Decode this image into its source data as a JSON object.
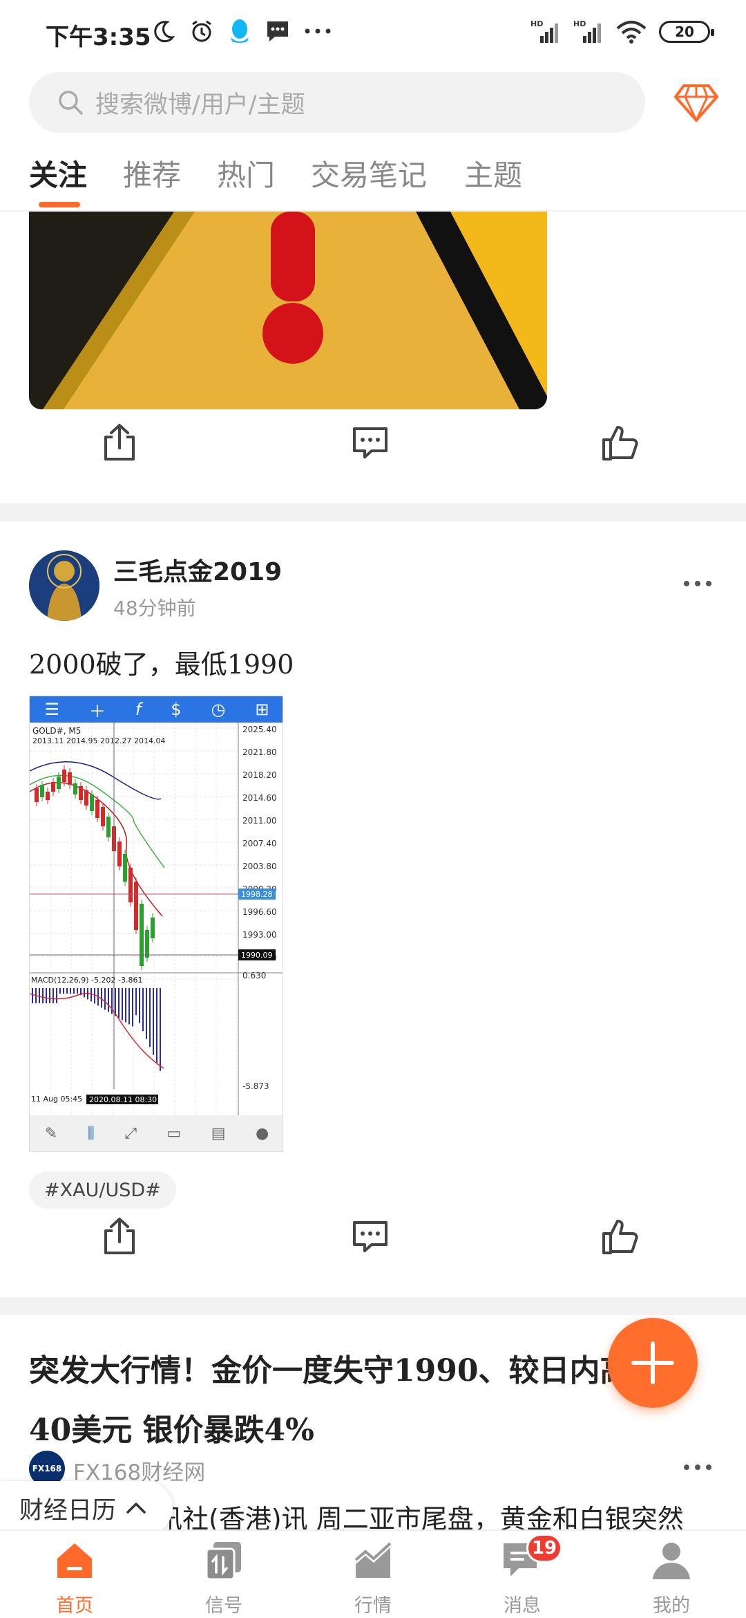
{
  "status_bar": {
    "time": "下午3:35",
    "network_labels": [
      "HD",
      "HD"
    ],
    "battery": "20"
  },
  "header": {
    "search_placeholder": "搜索微博/用户/主题",
    "search_icon": "search-icon",
    "vip_icon": "diamond-icon"
  },
  "tabs": [
    {
      "label": "关注",
      "active": true
    },
    {
      "label": "推荐",
      "active": false
    },
    {
      "label": "热门",
      "active": false
    },
    {
      "label": "交易笔记",
      "active": false
    },
    {
      "label": "主题",
      "active": false
    }
  ],
  "post2": {
    "author": "三毛点金2019",
    "time": "48分钟前",
    "text": "2000破了，最低1990",
    "tag": "#XAU/USD#",
    "chart": {
      "symbol": "GOLD#, M5",
      "ohlc": "2013.11 2014.95 2012.27 2014.04",
      "price_labels": [
        "2025.40",
        "2021.80",
        "2018.20",
        "2014.60",
        "2011.00",
        "2007.40",
        "2003.80",
        "2000.20",
        "1996.60",
        "1993.00",
        "1989.40"
      ],
      "current_price": "1998.28",
      "low_price": "1990.09",
      "macd_label": "MACD(12,26,9) -5.202 -3.861",
      "macd_top": "0.630",
      "macd_bottom": "-5.873",
      "time_start": "11 Aug 05:45",
      "time_cursor": "2020.08.11 08:30"
    }
  },
  "post3": {
    "headline": "突发大行情！金价一度失守1990、较日内高点跌40美元 银价暴跌4%",
    "source_logo": "FX168",
    "source": "FX168财经网",
    "snippet": "讯社(香港)讯 周二亚市尾盘，黄金和白银突然"
  },
  "calendar_pill": {
    "label": "财经日历"
  },
  "bottom_nav": [
    {
      "label": "首页",
      "active": true,
      "icon": "home-icon"
    },
    {
      "label": "信号",
      "active": false,
      "icon": "signal-icon"
    },
    {
      "label": "行情",
      "active": false,
      "icon": "market-icon"
    },
    {
      "label": "消息",
      "active": false,
      "icon": "message-icon",
      "badge": "19"
    },
    {
      "label": "我的",
      "active": false,
      "icon": "profile-icon"
    }
  ],
  "colors": {
    "accent": "#ff6a2a",
    "badge": "#f23b30",
    "chart_toolbar": "#2b74e4"
  }
}
